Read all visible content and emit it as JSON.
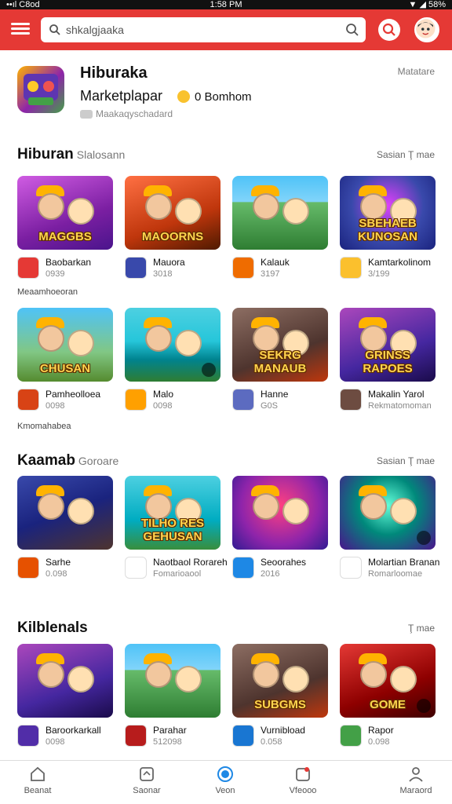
{
  "status": {
    "left": "••ıl C8od",
    "time": "1:58 PM",
    "right": "▼ ◢ 58%"
  },
  "search": {
    "placeholder": "shkalgjaaka",
    "value": "shkalgjaaka"
  },
  "app": {
    "title": "Hiburaka",
    "subtitle": "Marketplapar",
    "rating_text": "0 Bomhom",
    "meta": "Maakaqyschadard",
    "right_label": "Matatare"
  },
  "sections": [
    {
      "title": "Hiburan",
      "subtitle": "Slalosann",
      "right": "Sasian  Ţ mae",
      "rows": [
        [
          {
            "name": "Baobarkan",
            "stat": "0939",
            "thumb_text": "MAGGBS",
            "theme": "purple",
            "mini": "#e53935"
          },
          {
            "name": "Mauora",
            "stat": "3018",
            "thumb_text": "MAOORNS",
            "theme": "orange",
            "mini": "#3949ab"
          },
          {
            "name": "Kalauk",
            "stat": "3197",
            "thumb_text": "",
            "theme": "green",
            "mini": "#ef6c00"
          },
          {
            "name": "Kamtarkolinom",
            "stat": "3/199",
            "thumb_text": "SBEHAEB KUNOSAN",
            "theme": "blue",
            "mini": "#fbc02d"
          }
        ],
        [
          {
            "name": "Pamheolloea",
            "stat": "0098",
            "thumb_text": "CHUSAN",
            "theme": "sky",
            "mini": "#d84315"
          },
          {
            "name": "Malo",
            "stat": "0098",
            "thumb_text": "",
            "theme": "lake",
            "mini": "#ffa000"
          },
          {
            "name": "Hanne",
            "stat": "G0S",
            "thumb_text": "SEKRG MANAUB",
            "theme": "brown",
            "mini": "#5c6bc0"
          },
          {
            "name": "Makalin Yarol",
            "stat": "Rekmatomoman",
            "thumb_text": "GRINSS RAPOES",
            "theme": "violet",
            "mini": "#6d4c41"
          }
        ]
      ],
      "captions": [
        "Meaamhoeoran",
        "Kmomahabea"
      ]
    },
    {
      "title": "Kaamab",
      "subtitle": "Goroare",
      "right": "Sasian  Ţ mae",
      "rows": [
        [
          {
            "name": "Sarhe",
            "stat": "0.098",
            "thumb_text": "",
            "theme": "dark",
            "mini": "#e65100"
          },
          {
            "name": "Naotbaol Rorareh",
            "stat": "Fomarioaool",
            "thumb_text": "TILHO RES GEHUSAN",
            "theme": "cyan",
            "mini": "#ffffff"
          },
          {
            "name": "Seoorahes",
            "stat": "2016",
            "thumb_text": "",
            "theme": "magenta",
            "mini": "#1e88e5"
          },
          {
            "name": "Molartian Branan",
            "stat": "Romarloomae",
            "thumb_text": "",
            "theme": "teal",
            "mini": "#ffffff"
          }
        ]
      ],
      "captions": []
    },
    {
      "title": "Kilblenals",
      "subtitle": "",
      "right": "Ţ mae",
      "rows": [
        [
          {
            "name": "Baroorkarkall",
            "stat": "0098",
            "thumb_text": "",
            "theme": "violet",
            "mini": "#512da8"
          },
          {
            "name": "Parahar",
            "stat": "512098",
            "thumb_text": "",
            "theme": "green",
            "mini": "#b71c1c"
          },
          {
            "name": "Vurnibload",
            "stat": "0.058",
            "thumb_text": "SUBGMS",
            "theme": "brown",
            "mini": "#1976d2"
          },
          {
            "name": "Rapor",
            "stat": "0.098",
            "thumb_text": "GOME",
            "theme": "red",
            "mini": "#43a047"
          }
        ]
      ],
      "captions": []
    }
  ],
  "bottom_nav": [
    {
      "label": "Beanat",
      "icon": "home-icon"
    },
    {
      "label": "Saonar",
      "icon": "store-icon"
    },
    {
      "label": "Veon",
      "icon": "circle-icon"
    },
    {
      "label": "Vfeooo",
      "icon": "video-icon"
    },
    {
      "label": "Maraord",
      "icon": "profile-icon"
    }
  ]
}
